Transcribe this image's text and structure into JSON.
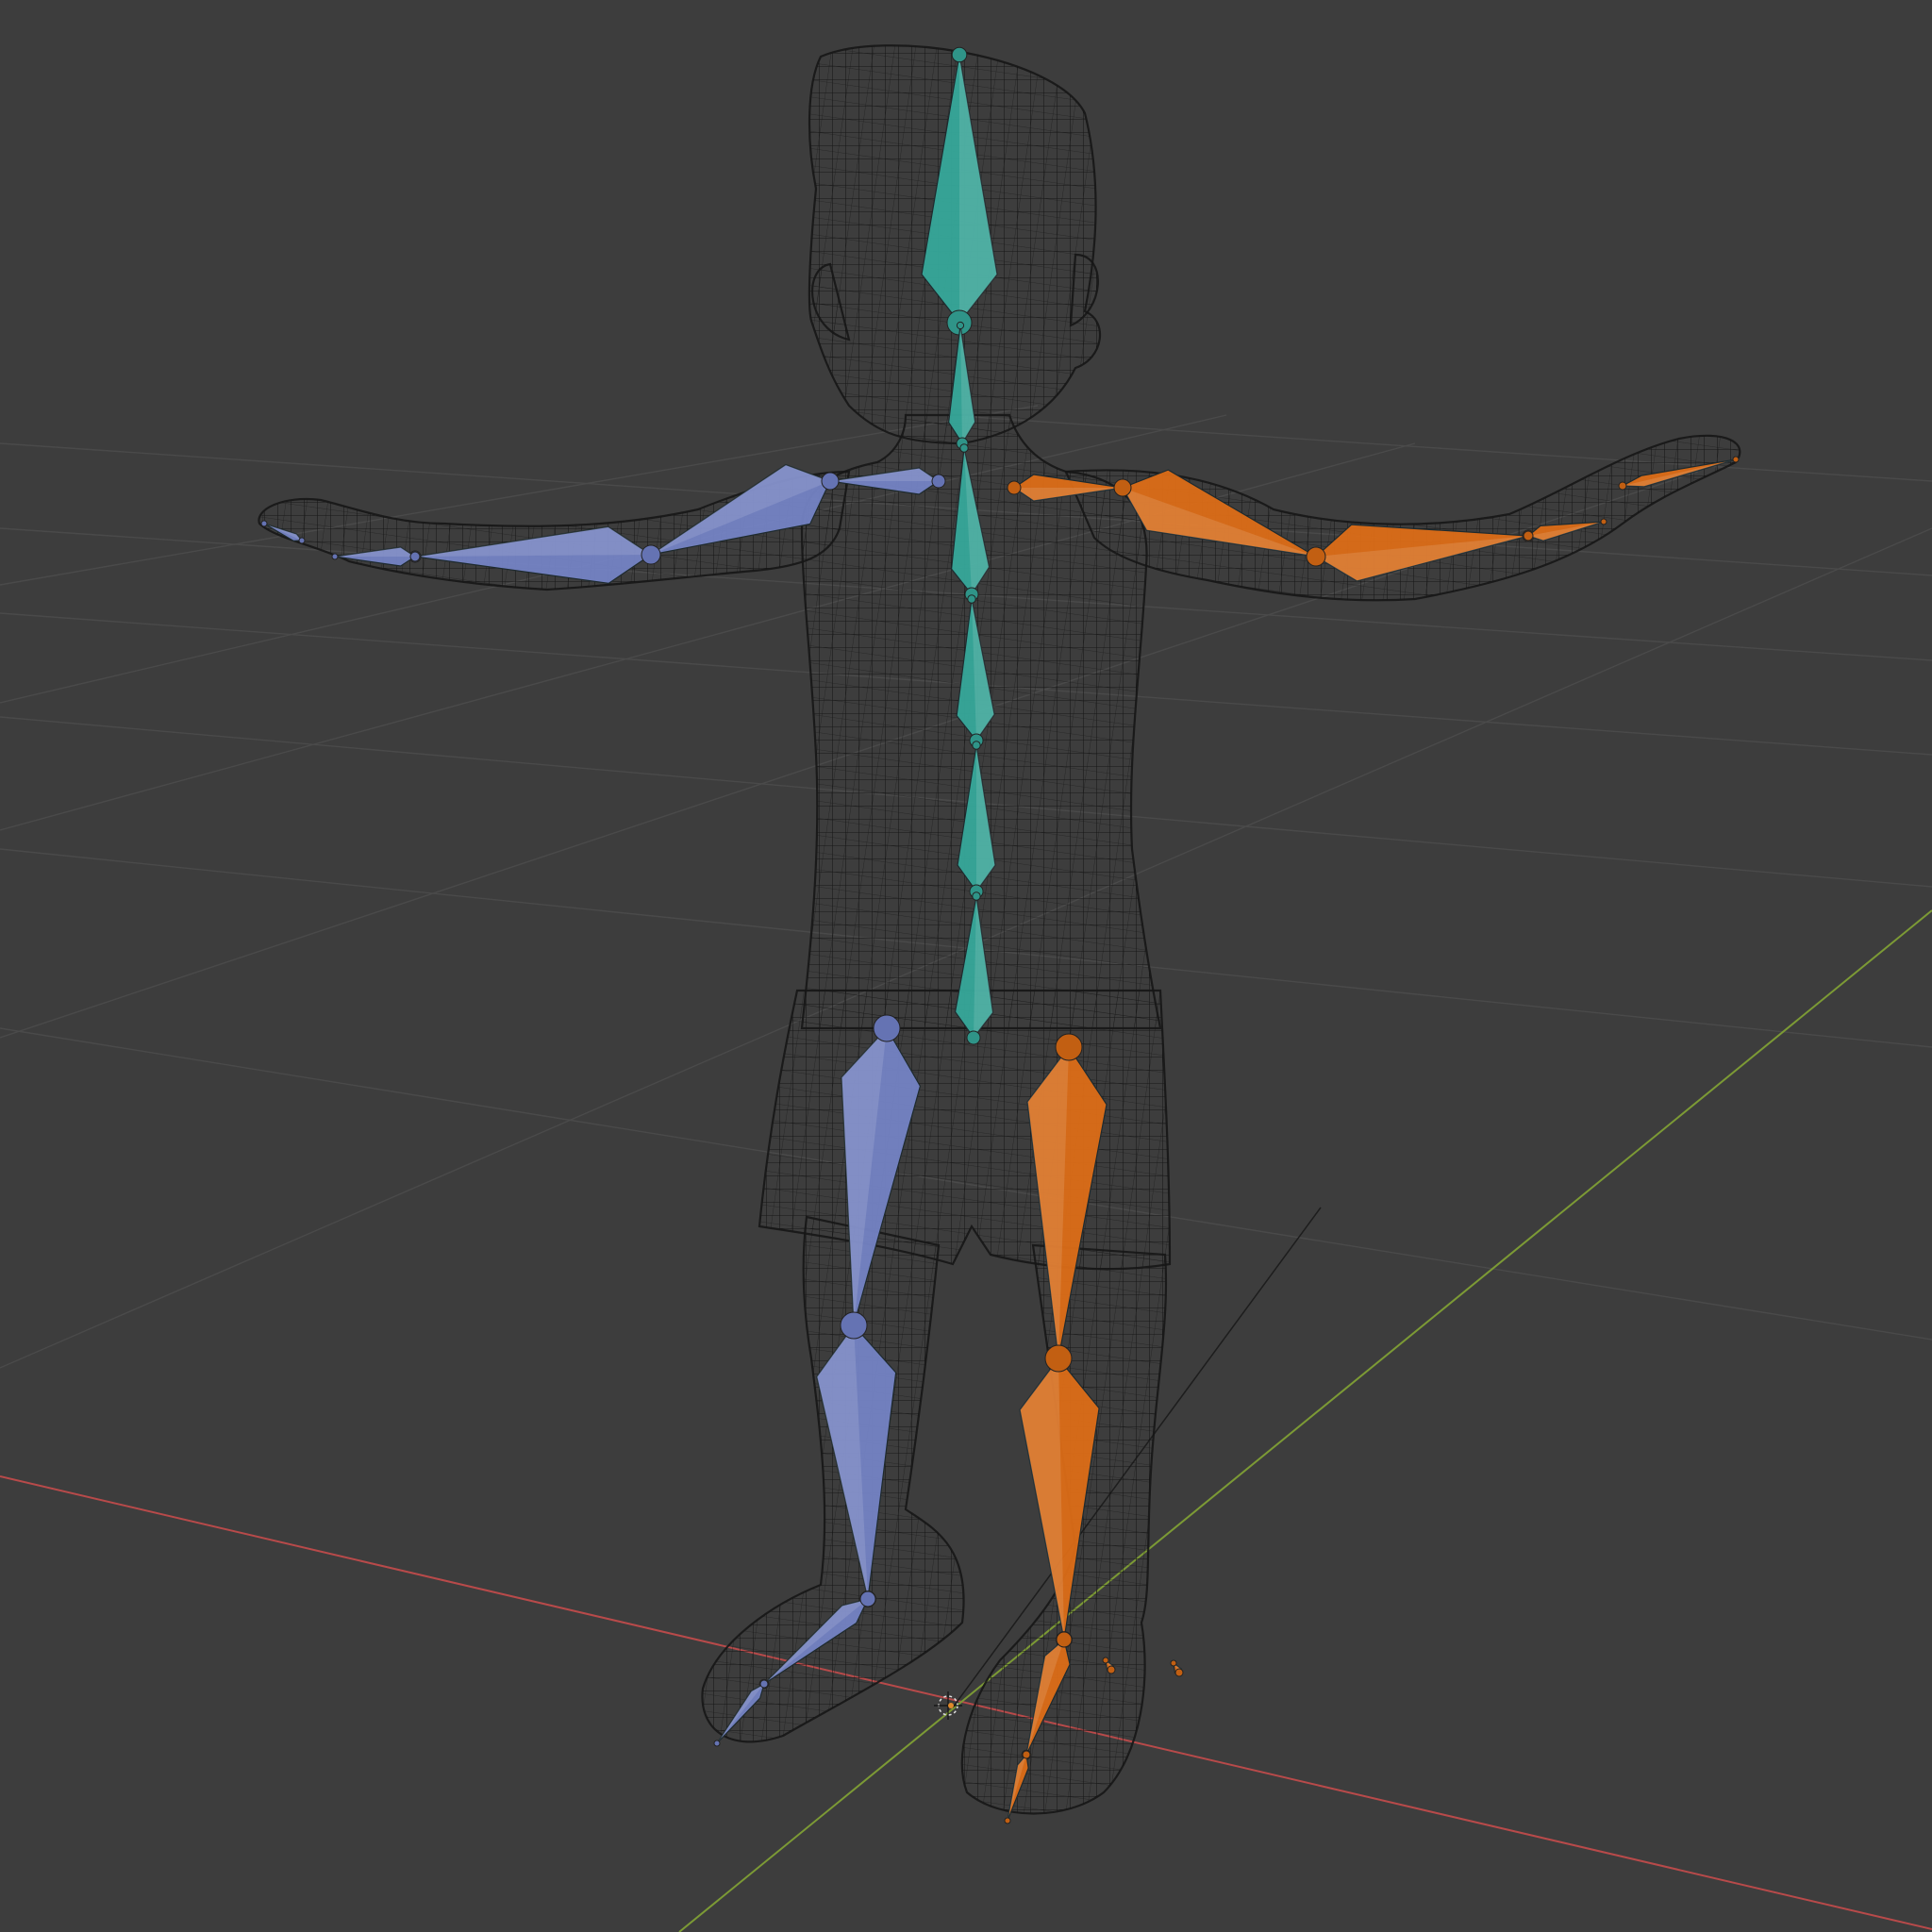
{
  "viewport": {
    "background": "#3d3d3d",
    "grid_color": "#4a4a4a",
    "x_axis_color": "#b84a4a",
    "y_axis_color": "#7c9a35",
    "wire_color": "#161616"
  },
  "bone_groups": {
    "spine": {
      "color": "#36a89a",
      "joint": "#2f9488"
    },
    "left_limbs": {
      "color": "#7483c4",
      "joint": "#6573b3"
    },
    "right_limbs": {
      "color": "#dc6d17",
      "joint": "#c25f12"
    }
  },
  "icons": {
    "origin": "3d-cursor-icon"
  }
}
